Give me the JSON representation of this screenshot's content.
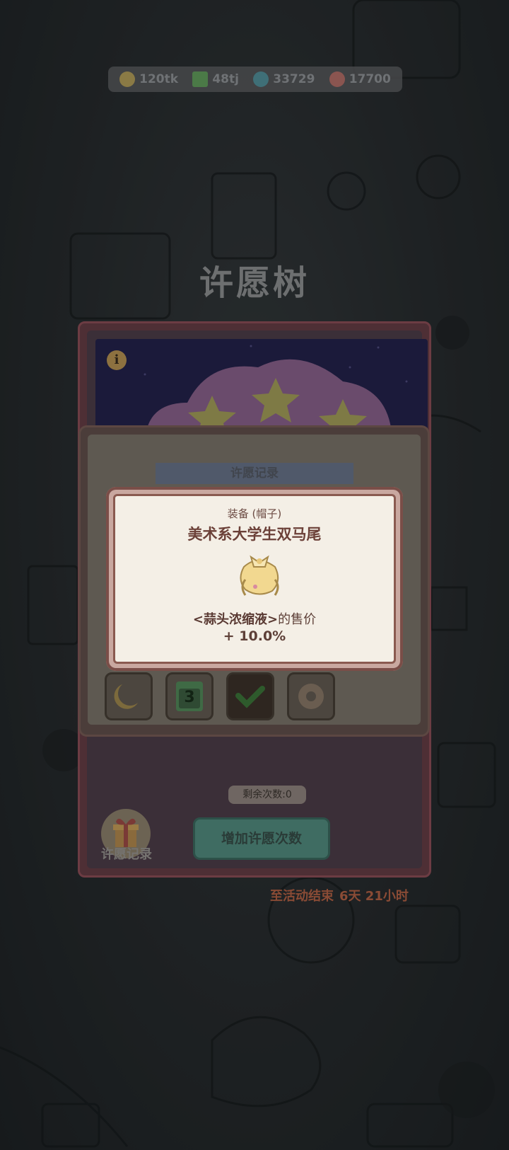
{
  "resources": [
    {
      "icon": "coin-icon",
      "value": "120tk",
      "color": "#8a7a45"
    },
    {
      "icon": "energy-icon",
      "value": "48tj",
      "color": "#4b7a47"
    },
    {
      "icon": "gem-icon",
      "value": "33729",
      "color": "#3f6f77"
    },
    {
      "icon": "ticket-icon",
      "value": "17700",
      "color": "#8a5550"
    }
  ],
  "page_title": "许愿树",
  "wish": {
    "info_glyph": "i",
    "remaining": "剩余次数:0",
    "add_button": "增加许愿次数",
    "history_button": "许愿记录",
    "countdown_label": "至活动结束",
    "countdown_value": "6天 21小时"
  },
  "history_panel": {
    "header": "许愿记录",
    "slot_icons": [
      "moon-cat-icon",
      "day-3-icon",
      "check-icon",
      "donut-icon"
    ],
    "slot_text": "3"
  },
  "popup": {
    "type": "装备 (帽子)",
    "name": "美术系大学生双马尾",
    "item_icon": "bow-pigtails-icon",
    "effect_item": "<蒜头浓缩液>",
    "effect_suffix": "的售价",
    "bonus": "+ 10.0%"
  },
  "colors": {
    "card_border": "#6c3c43",
    "popup_bg": "#f4efe6",
    "popup_text": "#6b4038",
    "button_green": "#3f6c62"
  }
}
